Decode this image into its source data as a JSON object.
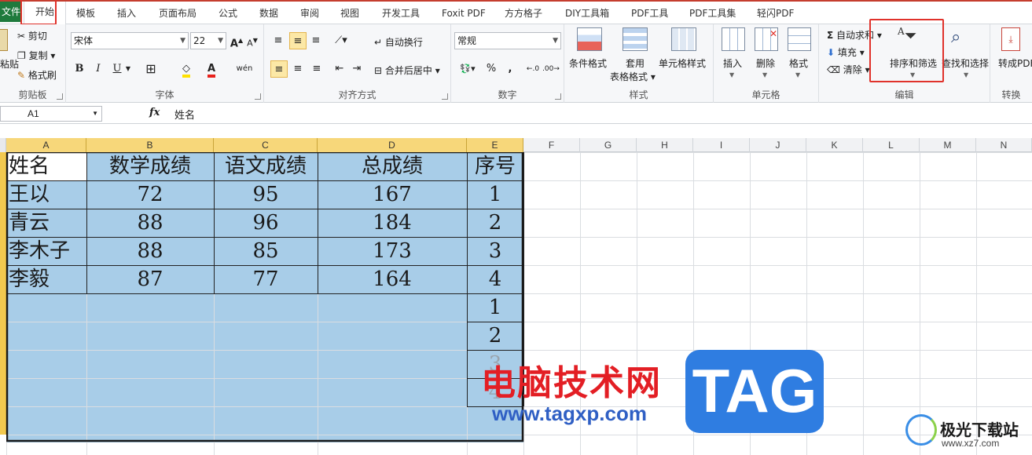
{
  "tabs": {
    "file": "文件",
    "home": "开始",
    "items": [
      "模板",
      "插入",
      "页面布局",
      "公式",
      "数据",
      "审阅",
      "视图",
      "开发工具",
      "Foxit PDF",
      "方方格子",
      "DIY工具箱",
      "PDF工具",
      "PDF工具集",
      "轻闪PDF"
    ]
  },
  "ribbon": {
    "clipboard": {
      "label": "剪贴板",
      "paste": "粘贴",
      "cut": "剪切",
      "copy": "复制",
      "painter": "格式刷"
    },
    "font": {
      "label": "字体",
      "name": "宋体",
      "size": "22",
      "bold": "B",
      "italic": "I",
      "underline": "U",
      "grow": "A",
      "shrink": "A"
    },
    "align": {
      "label": "对齐方式",
      "wrap": "自动换行",
      "merge": "合并后居中"
    },
    "number": {
      "label": "数字",
      "format": "常规",
      "percent": "%",
      "comma": ","
    },
    "styles": {
      "label": "样式",
      "conditional": "条件格式",
      "table1": "套用",
      "table2": "表格格式",
      "cellstyle": "单元格样式"
    },
    "cells": {
      "label": "单元格",
      "insert": "插入",
      "delete": "删除",
      "format": "格式"
    },
    "editing": {
      "label": "编辑",
      "autosum": "自动求和",
      "fill": "填充",
      "clear": "清除",
      "sort": "排序和筛选",
      "find": "查找和选择"
    },
    "convert": {
      "label": "转换",
      "topdf": "转成PDF"
    }
  },
  "formula": {
    "cell": "A1",
    "fx": "fx",
    "content": "姓名"
  },
  "columns": [
    "A",
    "B",
    "C",
    "D",
    "E",
    "F",
    "G",
    "H",
    "I",
    "J",
    "K",
    "L",
    "M",
    "N"
  ],
  "sheet": {
    "headers": [
      "姓名",
      "数学成绩",
      "语文成绩",
      "总成绩",
      "序号"
    ],
    "rows": [
      [
        "王以",
        "72",
        "95",
        "167",
        "1"
      ],
      [
        "青云",
        "88",
        "96",
        "184",
        "2"
      ],
      [
        "李木子",
        "88",
        "85",
        "173",
        "3"
      ],
      [
        "李毅",
        "87",
        "77",
        "164",
        "4"
      ]
    ],
    "extra_seq": [
      "1",
      "2",
      "3",
      "4"
    ]
  },
  "watermark": {
    "cn": "电脑技术网",
    "url": "www.tagxp.com",
    "tag": "TAG",
    "site": "极光下载站",
    "site_url": "www.xz7.com"
  },
  "colors": {
    "selection": "#a8cde8",
    "accent_red": "#e0322b",
    "header_sel": "#f7d77a",
    "tag_blue": "#2f7de1"
  }
}
